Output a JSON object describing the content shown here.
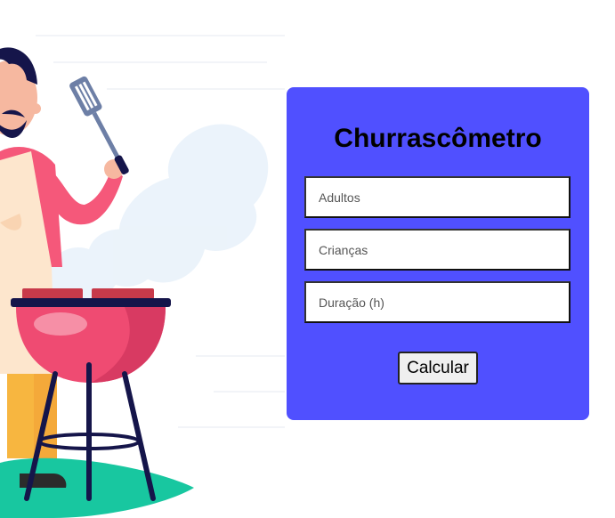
{
  "form": {
    "title": "Churrascômetro",
    "adults_placeholder": "Adultos",
    "children_placeholder": "Crianças",
    "duration_placeholder": "Duração (h)",
    "submit_label": "Calcular"
  },
  "colors": {
    "card_background": "#5050ff",
    "grill_body": "#ef4b72",
    "shirt": "#f5587a",
    "ground": "#18c7a0"
  }
}
